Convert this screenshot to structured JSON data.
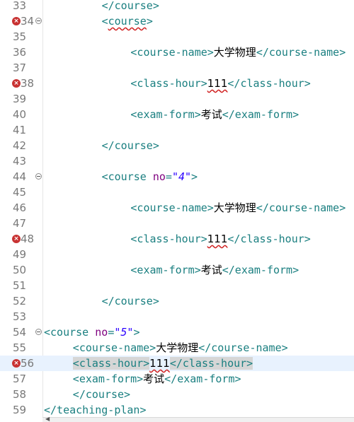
{
  "editor": {
    "lines": [
      {
        "no": "33",
        "indent": 8,
        "error": false,
        "fold": false,
        "current": false,
        "parts": [
          {
            "c": "tag",
            "t": "</course>"
          }
        ]
      },
      {
        "no": "34",
        "indent": 8,
        "error": true,
        "fold": true,
        "current": false,
        "parts": [
          {
            "c": "tag",
            "t": "<"
          },
          {
            "c": "tag squiggle",
            "t": "course"
          },
          {
            "c": "tag",
            "t": ">"
          }
        ]
      },
      {
        "no": "35",
        "indent": 0,
        "error": false,
        "fold": false,
        "current": false,
        "parts": []
      },
      {
        "no": "36",
        "indent": 12,
        "error": false,
        "fold": false,
        "current": false,
        "parts": [
          {
            "c": "tag",
            "t": "<course-name>"
          },
          {
            "c": "txt",
            "t": "大学物理"
          },
          {
            "c": "tag",
            "t": "</course-name>"
          }
        ]
      },
      {
        "no": "37",
        "indent": 0,
        "error": false,
        "fold": false,
        "current": false,
        "parts": []
      },
      {
        "no": "38",
        "indent": 12,
        "error": true,
        "fold": false,
        "current": false,
        "parts": [
          {
            "c": "tag",
            "t": "<class-hour>"
          },
          {
            "c": "txt squiggle",
            "t": "111"
          },
          {
            "c": "tag",
            "t": "</class-hour>"
          }
        ]
      },
      {
        "no": "39",
        "indent": 0,
        "error": false,
        "fold": false,
        "current": false,
        "parts": []
      },
      {
        "no": "40",
        "indent": 12,
        "error": false,
        "fold": false,
        "current": false,
        "parts": [
          {
            "c": "tag",
            "t": "<exam-form>"
          },
          {
            "c": "txt",
            "t": "考试"
          },
          {
            "c": "tag",
            "t": "</exam-form>"
          }
        ]
      },
      {
        "no": "41",
        "indent": 0,
        "error": false,
        "fold": false,
        "current": false,
        "parts": []
      },
      {
        "no": "42",
        "indent": 8,
        "error": false,
        "fold": false,
        "current": false,
        "parts": [
          {
            "c": "tag",
            "t": "</course>"
          }
        ]
      },
      {
        "no": "43",
        "indent": 0,
        "error": false,
        "fold": false,
        "current": false,
        "parts": []
      },
      {
        "no": "44",
        "indent": 8,
        "error": false,
        "fold": true,
        "current": false,
        "parts": [
          {
            "c": "tag",
            "t": "<course "
          },
          {
            "c": "attr",
            "t": "no"
          },
          {
            "c": "tag",
            "t": "="
          },
          {
            "c": "val",
            "t": "\"4\""
          },
          {
            "c": "tag",
            "t": ">"
          }
        ]
      },
      {
        "no": "45",
        "indent": 0,
        "error": false,
        "fold": false,
        "current": false,
        "parts": []
      },
      {
        "no": "46",
        "indent": 12,
        "error": false,
        "fold": false,
        "current": false,
        "parts": [
          {
            "c": "tag",
            "t": "<course-name>"
          },
          {
            "c": "txt",
            "t": "大学物理"
          },
          {
            "c": "tag",
            "t": "</course-name>"
          }
        ]
      },
      {
        "no": "47",
        "indent": 0,
        "error": false,
        "fold": false,
        "current": false,
        "parts": []
      },
      {
        "no": "48",
        "indent": 12,
        "error": true,
        "fold": false,
        "current": false,
        "parts": [
          {
            "c": "tag",
            "t": "<class-hour>"
          },
          {
            "c": "txt squiggle",
            "t": "111"
          },
          {
            "c": "tag",
            "t": "</class-hour>"
          }
        ]
      },
      {
        "no": "49",
        "indent": 0,
        "error": false,
        "fold": false,
        "current": false,
        "parts": []
      },
      {
        "no": "50",
        "indent": 12,
        "error": false,
        "fold": false,
        "current": false,
        "parts": [
          {
            "c": "tag",
            "t": "<exam-form>"
          },
          {
            "c": "txt",
            "t": "考试"
          },
          {
            "c": "tag",
            "t": "</exam-form>"
          }
        ]
      },
      {
        "no": "51",
        "indent": 0,
        "error": false,
        "fold": false,
        "current": false,
        "parts": []
      },
      {
        "no": "52",
        "indent": 8,
        "error": false,
        "fold": false,
        "current": false,
        "parts": [
          {
            "c": "tag",
            "t": "</course>"
          }
        ]
      },
      {
        "no": "53",
        "indent": 0,
        "error": false,
        "fold": false,
        "current": false,
        "parts": []
      },
      {
        "no": "54",
        "indent": 0,
        "error": false,
        "fold": true,
        "current": false,
        "parts": [
          {
            "c": "tag",
            "t": "<course "
          },
          {
            "c": "attr",
            "t": "no"
          },
          {
            "c": "tag",
            "t": "="
          },
          {
            "c": "val",
            "t": "\"5\""
          },
          {
            "c": "tag",
            "t": ">"
          }
        ]
      },
      {
        "no": "55",
        "indent": 4,
        "error": false,
        "fold": false,
        "current": false,
        "parts": [
          {
            "c": "tag",
            "t": "<course-name>"
          },
          {
            "c": "txt",
            "t": "大学物理"
          },
          {
            "c": "tag",
            "t": "</course-name>"
          }
        ]
      },
      {
        "no": "56",
        "indent": 4,
        "error": true,
        "fold": false,
        "current": true,
        "parts": [
          {
            "c": "caret",
            "t": ""
          },
          {
            "c": "tag hl",
            "t": "<class-hour>"
          },
          {
            "c": "txt squiggle",
            "t": "111"
          },
          {
            "c": "tag hl",
            "t": "</class-hour>"
          }
        ]
      },
      {
        "no": "57",
        "indent": 4,
        "error": false,
        "fold": false,
        "current": false,
        "parts": [
          {
            "c": "tag",
            "t": "<exam-form>"
          },
          {
            "c": "txt",
            "t": "考试"
          },
          {
            "c": "tag",
            "t": "</exam-form>"
          }
        ]
      },
      {
        "no": "58",
        "indent": 4,
        "error": false,
        "fold": false,
        "current": false,
        "parts": [
          {
            "c": "tag",
            "t": "</course>"
          }
        ]
      },
      {
        "no": "59",
        "indent": 0,
        "error": false,
        "fold": false,
        "current": false,
        "parts": [
          {
            "c": "tag",
            "t": "</teaching-plan>"
          }
        ]
      }
    ]
  },
  "colors": {
    "tag": "#1a7f80",
    "attribute": "#7f007f",
    "value": "#2a00ff",
    "error": "#c83232",
    "current_line": "#e8f2fe"
  },
  "icons": {
    "error_marker": "error-icon",
    "fold_marker": "collapse-icon",
    "scroll_arrow": "scroll-left-icon"
  }
}
